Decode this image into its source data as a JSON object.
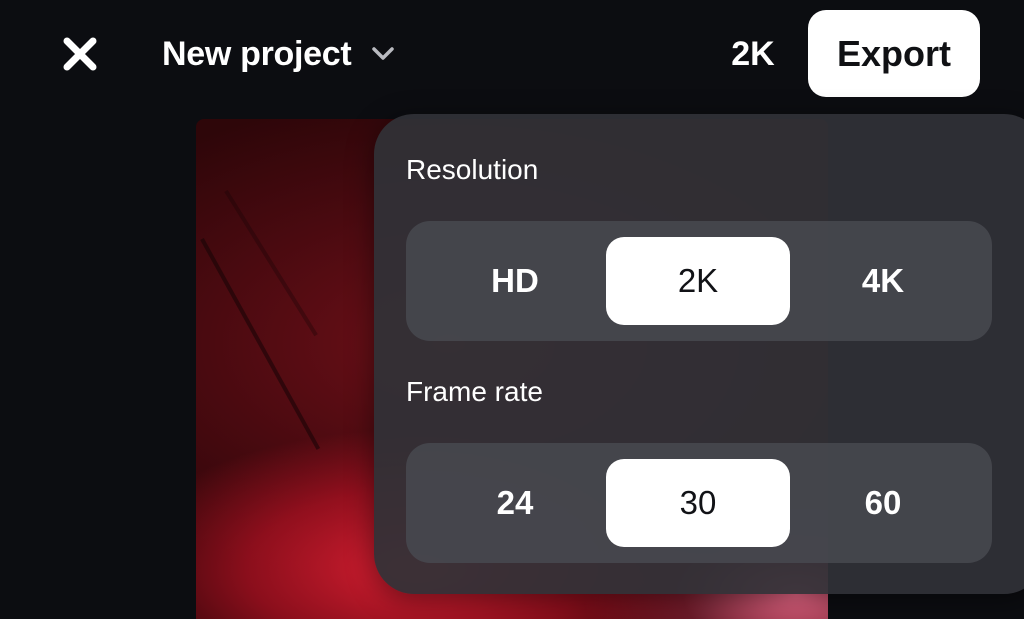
{
  "header": {
    "title": "New project",
    "current_resolution": "2K",
    "export_label": "Export"
  },
  "icons": {
    "close": "close-icon",
    "title_dropdown": "chevron-down-icon"
  },
  "settings": {
    "resolution": {
      "label": "Resolution",
      "options": [
        "HD",
        "2K",
        "4K"
      ],
      "selected": "2K"
    },
    "frame_rate": {
      "label": "Frame rate",
      "options": [
        "24",
        "30",
        "60"
      ],
      "selected": "30"
    }
  },
  "colors": {
    "background": "#0c0d11",
    "popover": "#303137",
    "segment_track": "#484950",
    "selected_option": "#ffffff",
    "export_button": "#ffffff"
  }
}
